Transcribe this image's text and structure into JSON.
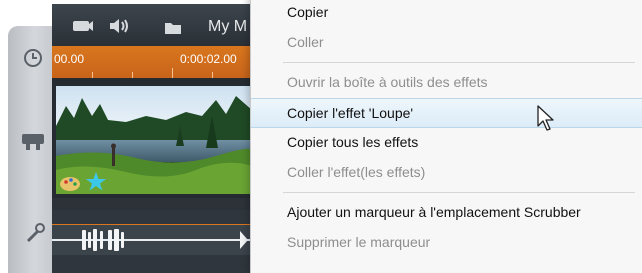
{
  "editor": {
    "title": "My M",
    "ruler": {
      "start_time": "00.00",
      "mid_time": "0:00:02.00"
    }
  },
  "context_menu": {
    "items": [
      {
        "label": "Copier",
        "enabled": true
      },
      {
        "label": "Coller",
        "enabled": false
      },
      {
        "label": "Ouvrir la boîte à outils des effets",
        "enabled": false
      },
      {
        "label": "Copier l'effet 'Loupe'",
        "enabled": true,
        "highlighted": true
      },
      {
        "label": "Copier tous les effets",
        "enabled": true
      },
      {
        "label": "Coller l'effet(les effets)",
        "enabled": false
      },
      {
        "label": "Ajouter un marqueur à l'emplacement Scrubber",
        "enabled": true
      },
      {
        "label": "Supprimer le marqueur",
        "enabled": false
      }
    ]
  },
  "icons": {
    "clock": "clock-icon",
    "camera": "camera-icon",
    "microphone": "microphone-icon",
    "speaker": "speaker-icon",
    "folder": "folder-icon",
    "palette": "palette-icon",
    "star": "star-icon",
    "pointer": "mouse-pointer-icon"
  },
  "colors": {
    "accent_orange": "#D9761E",
    "highlight_blue": "#DCECF7",
    "star_cyan": "#3EC8E8"
  }
}
